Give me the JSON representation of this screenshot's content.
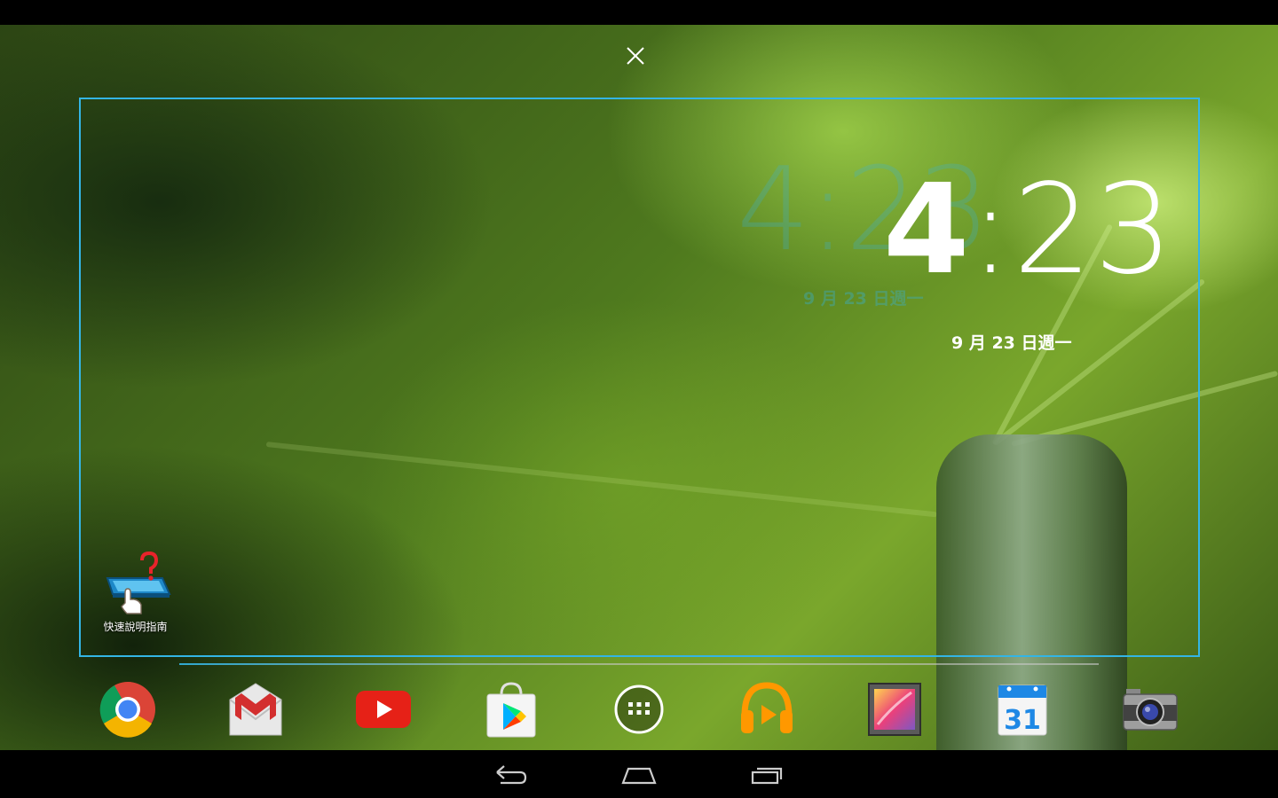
{
  "clock": {
    "hour": "4",
    "minutes": ":23",
    "ghost_time": "4:23",
    "date": "9 月 23 日週一",
    "ghost_date": "9 月 23 日週一"
  },
  "desktop": {
    "shortcut_label": "快速說明指南"
  },
  "dock": {
    "items": [
      {
        "name": "chrome-icon"
      },
      {
        "name": "gmail-icon"
      },
      {
        "name": "youtube-icon"
      },
      {
        "name": "play-store-icon"
      },
      {
        "name": "app-drawer-icon"
      },
      {
        "name": "play-music-icon"
      },
      {
        "name": "gallery-icon"
      },
      {
        "name": "calendar-icon",
        "text": "31"
      },
      {
        "name": "camera-icon"
      }
    ]
  },
  "colors": {
    "accent": "#33b5e5",
    "nav_bar": "#000000"
  }
}
